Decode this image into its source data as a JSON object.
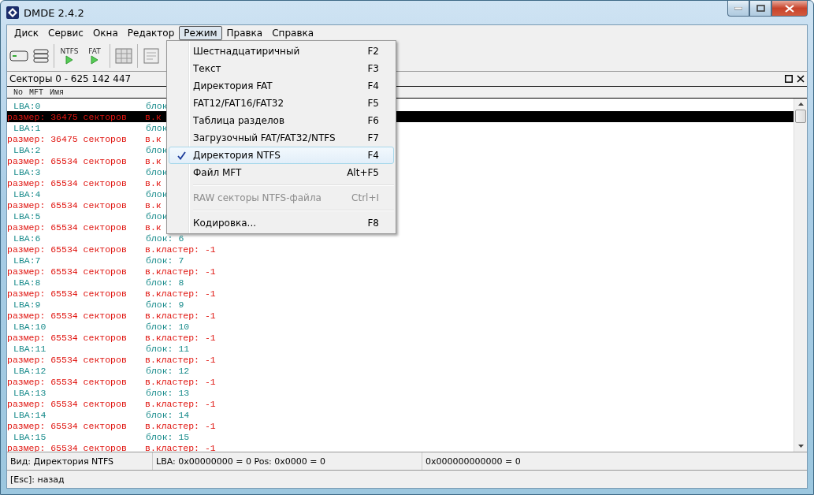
{
  "window": {
    "title": "DMDE 2.4.2"
  },
  "menubar": [
    {
      "label": "Диск",
      "selected": false
    },
    {
      "label": "Сервис",
      "selected": false
    },
    {
      "label": "Окна",
      "selected": false
    },
    {
      "label": "Редактор",
      "selected": false
    },
    {
      "label": "Режим",
      "selected": true
    },
    {
      "label": "Правка",
      "selected": false
    },
    {
      "label": "Справка",
      "selected": false
    }
  ],
  "toolbar": [
    {
      "kind": "drive"
    },
    {
      "kind": "list"
    },
    {
      "kind": "separator"
    },
    {
      "kind": "play",
      "label": "NTFS"
    },
    {
      "kind": "play",
      "label": "FAT"
    },
    {
      "kind": "separator"
    },
    {
      "kind": "grid"
    },
    {
      "kind": "separator"
    },
    {
      "kind": "doc"
    }
  ],
  "panel": {
    "title": "Секторы 0 - 625 142 447",
    "column_headers": [
      "No",
      "MFT",
      "Имя"
    ],
    "rows": [
      {
        "lba": "LBA:0",
        "block": "блок",
        "size": "размер: 36475 секторов",
        "cluster": "в.к",
        "selected": true
      },
      {
        "lba": "LBA:1",
        "block": "блок",
        "size": "размер: 36475 секторов",
        "cluster": "в.к",
        "selected": false
      },
      {
        "lba": "LBA:2",
        "block": "блок",
        "size": "размер: 65534 секторов",
        "cluster": "в.к",
        "selected": false
      },
      {
        "lba": "LBA:3",
        "block": "блок",
        "size": "размер: 65534 секторов",
        "cluster": "в.к",
        "selected": false
      },
      {
        "lba": "LBA:4",
        "block": "блок",
        "size": "размер: 65534 секторов",
        "cluster": "в.к",
        "selected": false
      },
      {
        "lba": "LBA:5",
        "block": "блок",
        "size": "размер: 65534 секторов",
        "cluster": "в.к",
        "selected": false
      },
      {
        "lba": "LBA:6",
        "block": "блок: 6",
        "size": "размер: 65534 секторов",
        "cluster": "в.кластер: -1",
        "selected": false
      },
      {
        "lba": "LBA:7",
        "block": "блок: 7",
        "size": "размер: 65534 секторов",
        "cluster": "в.кластер: -1",
        "selected": false
      },
      {
        "lba": "LBA:8",
        "block": "блок: 8",
        "size": "размер: 65534 секторов",
        "cluster": "в.кластер: -1",
        "selected": false
      },
      {
        "lba": "LBA:9",
        "block": "блок: 9",
        "size": "размер: 65534 секторов",
        "cluster": "в.кластер: -1",
        "selected": false
      },
      {
        "lba": "LBA:10",
        "block": "блок: 10",
        "size": "размер: 65534 секторов",
        "cluster": "в.кластер: -1",
        "selected": false
      },
      {
        "lba": "LBA:11",
        "block": "блок: 11",
        "size": "размер: 65534 секторов",
        "cluster": "в.кластер: -1",
        "selected": false
      },
      {
        "lba": "LBA:12",
        "block": "блок: 12",
        "size": "размер: 65534 секторов",
        "cluster": "в.кластер: -1",
        "selected": false
      },
      {
        "lba": "LBA:13",
        "block": "блок: 13",
        "size": "размер: 65534 секторов",
        "cluster": "в.кластер: -1",
        "selected": false
      },
      {
        "lba": "LBA:14",
        "block": "блок: 14",
        "size": "размер: 65534 секторов",
        "cluster": "в.кластер: -1",
        "selected": false
      },
      {
        "lba": "LBA:15",
        "block": "блок: 15",
        "size": "размер: 65534 секторов",
        "cluster": "в.кластер: -1",
        "selected": false
      }
    ]
  },
  "menu": {
    "items": [
      {
        "kind": "item",
        "label": "Шестнадцатиричный",
        "shortcut": "F2",
        "checked": false,
        "disabled": false,
        "selected": false
      },
      {
        "kind": "item",
        "label": "Текст",
        "shortcut": "F3",
        "checked": false,
        "disabled": false,
        "selected": false
      },
      {
        "kind": "item",
        "label": "Директория FAT",
        "shortcut": "F4",
        "checked": false,
        "disabled": false,
        "selected": false
      },
      {
        "kind": "item",
        "label": "FAT12/FAT16/FAT32",
        "shortcut": "F5",
        "checked": false,
        "disabled": false,
        "selected": false
      },
      {
        "kind": "item",
        "label": "Таблица разделов",
        "shortcut": "F6",
        "checked": false,
        "disabled": false,
        "selected": false
      },
      {
        "kind": "item",
        "label": "Загрузочный FAT/FAT32/NTFS",
        "shortcut": "F7",
        "checked": false,
        "disabled": false,
        "selected": false
      },
      {
        "kind": "item",
        "label": "Директория NTFS",
        "shortcut": "F4",
        "checked": true,
        "disabled": false,
        "selected": true
      },
      {
        "kind": "item",
        "label": "Файл MFT",
        "shortcut": "Alt+F5",
        "checked": false,
        "disabled": false,
        "selected": false
      },
      {
        "kind": "separator"
      },
      {
        "kind": "item",
        "label": "RAW секторы NTFS-файла",
        "shortcut": "Ctrl+I",
        "checked": false,
        "disabled": true,
        "selected": false
      },
      {
        "kind": "separator"
      },
      {
        "kind": "item",
        "label": "Кодировка...",
        "shortcut": "F8",
        "checked": false,
        "disabled": false,
        "selected": false
      }
    ]
  },
  "status_bar": [
    "Вид: Директория NTFS",
    "LBA: 0x00000000 = 0  Pos: 0x0000 = 0",
    "0x000000000000 = 0"
  ],
  "hint": "[Esc]: назад"
}
